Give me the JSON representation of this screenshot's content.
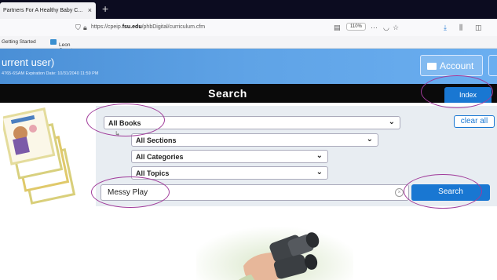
{
  "browser": {
    "tab_title": "Partners For A Healthy Baby C...",
    "tab_close": "×",
    "new_tab": "+",
    "url_prefix": "https://cpeip.",
    "url_domain": "fsu.edu",
    "url_path": "/phbDigital/curriculum.cfm",
    "zoom": "110%",
    "bookmarks": [
      "Getting Started",
      "Leon County School..."
    ]
  },
  "header": {
    "user_label": "urrent user)",
    "expiration": "4765-6SAM Expiration Date: 10/31/2040 11:59 PM",
    "account_label": "Account"
  },
  "search_bar": {
    "title": "Search",
    "index_label": "Index"
  },
  "filters": {
    "books": "All Books",
    "sections": "All Sections",
    "categories": "All Categories",
    "topics": "All Topics",
    "clear_label": "clear all"
  },
  "query": {
    "value": "Messy Play",
    "clear_glyph": "×",
    "button_label": "Search"
  },
  "colors": {
    "accent": "#1977d2",
    "annotation": "#a03b9a",
    "header_blue": "#5fa3e6"
  }
}
